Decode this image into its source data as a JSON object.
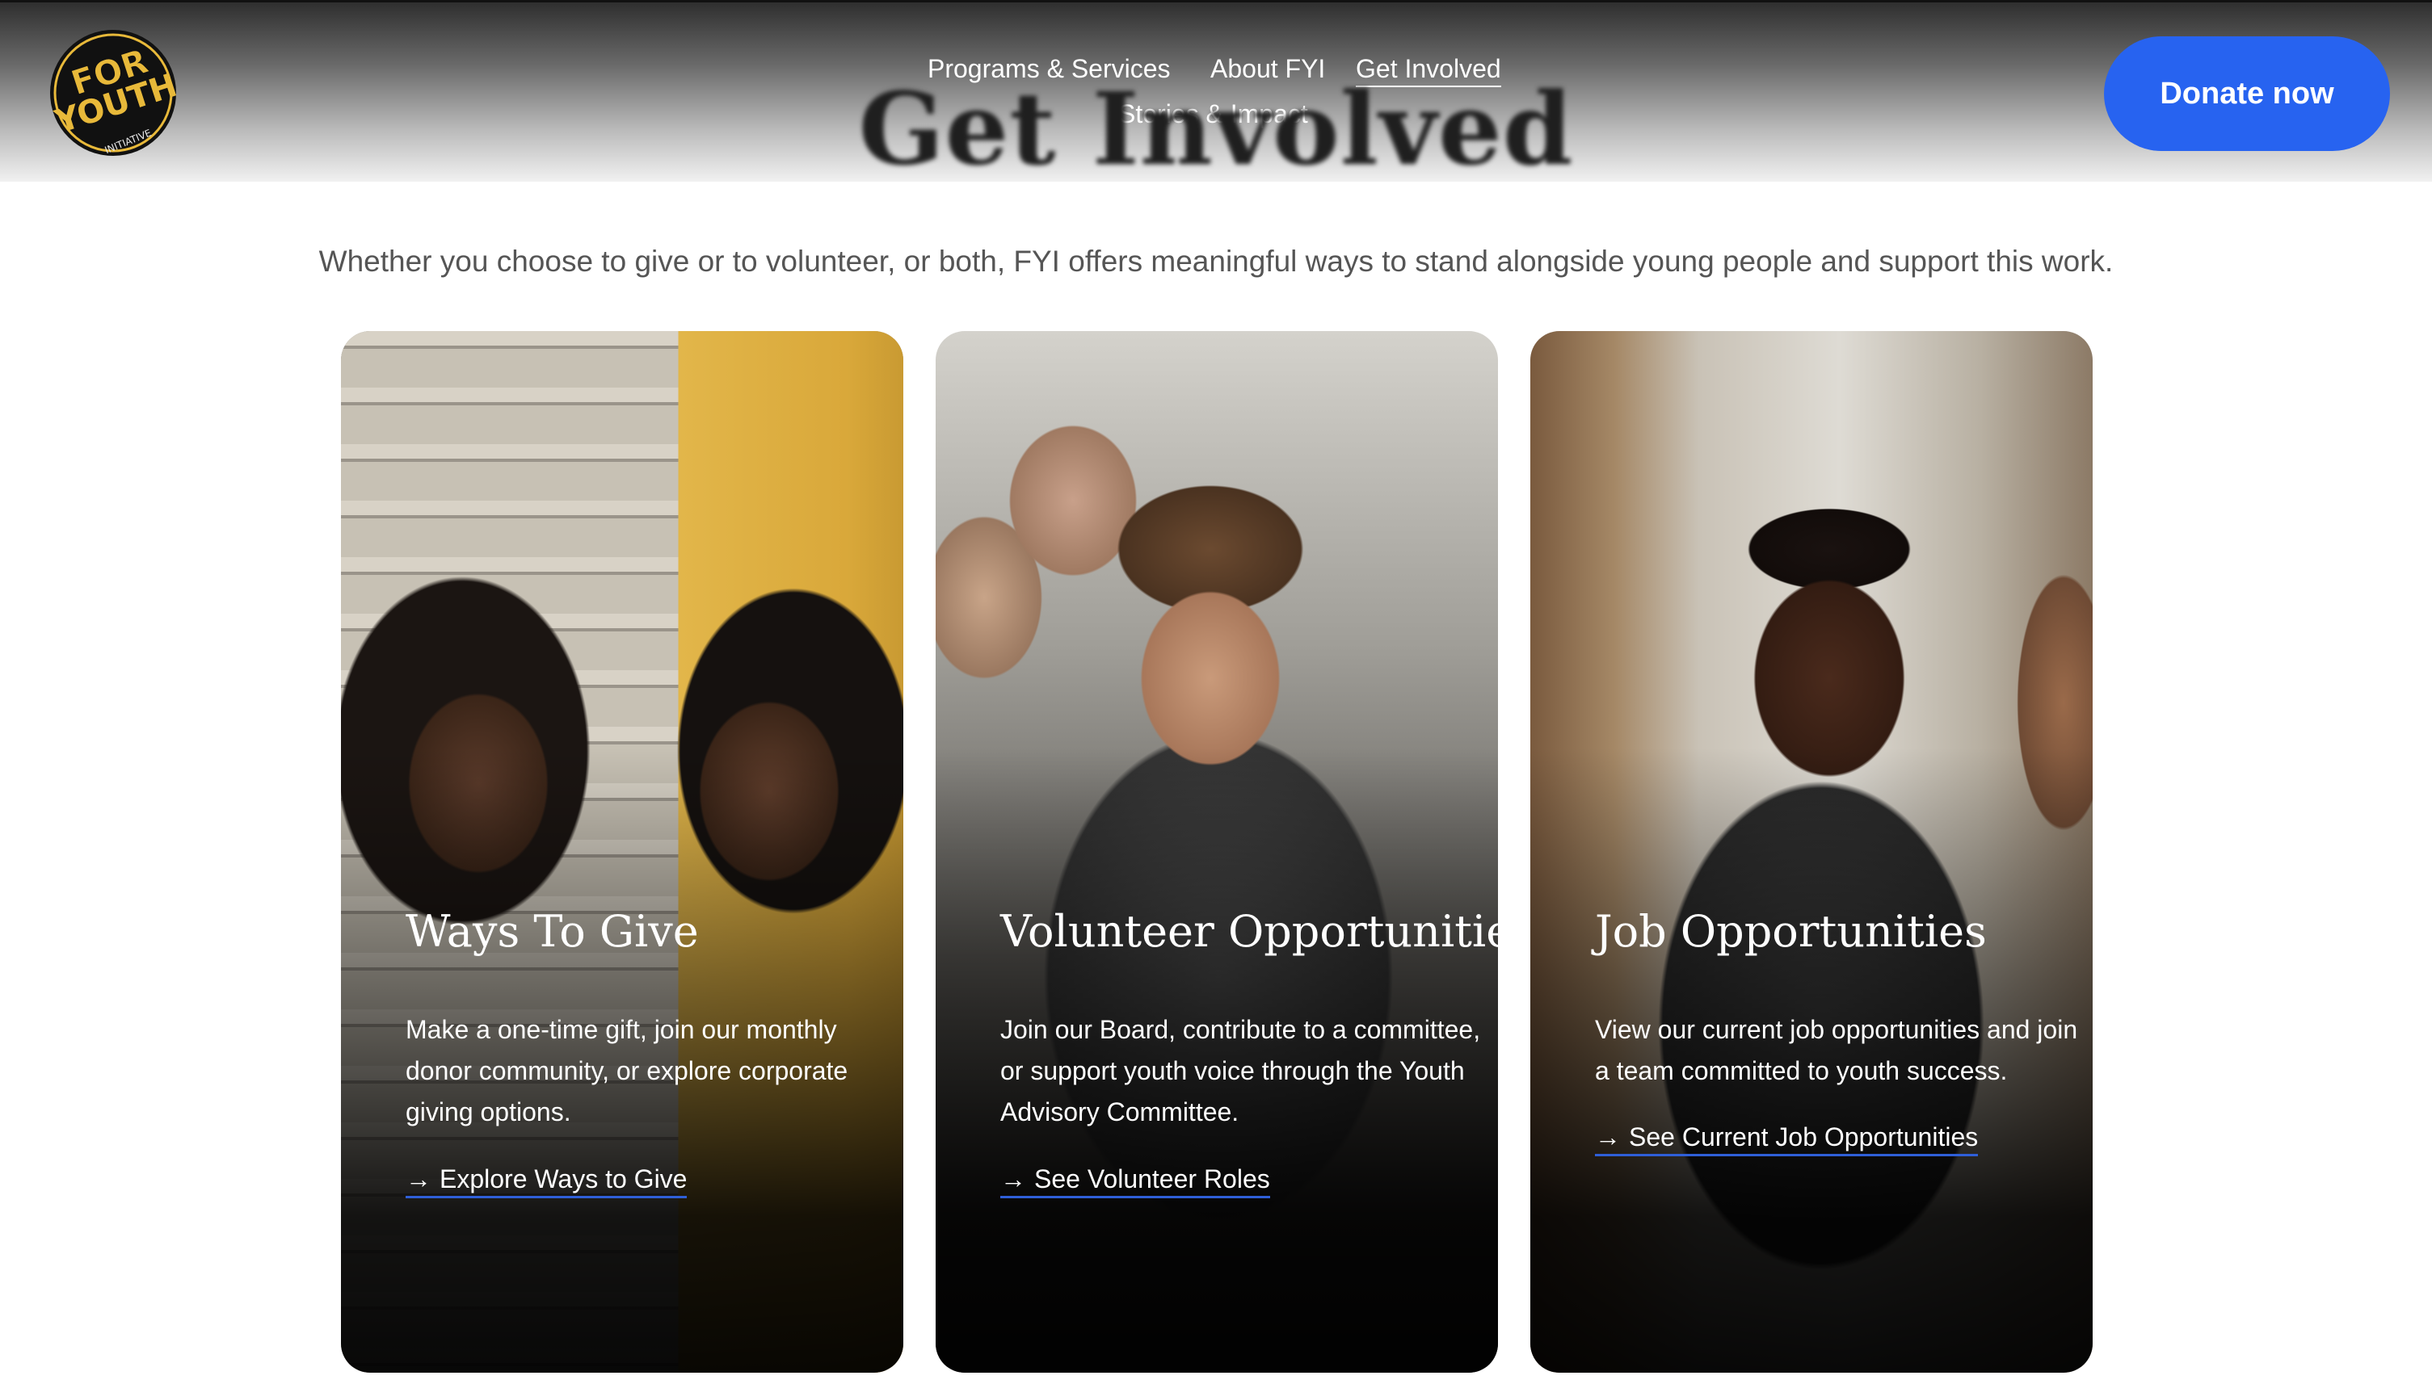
{
  "header": {
    "logo_alt": "FOR YOUTH INITIATIVE",
    "logo_text_top": "FOR",
    "logo_text_mid": "YOUTH",
    "logo_text_bottom": "INITIATIVE",
    "nav": [
      {
        "label": "Programs & Services"
      },
      {
        "label": "About FYI"
      },
      {
        "label": "Get Involved"
      },
      {
        "label": "Stories & Impact"
      }
    ],
    "donate_label": "Donate now",
    "colors": {
      "donate": "#2763f0",
      "logo_yellow": "#e8b93a"
    }
  },
  "hero": {
    "title": "Get Involved",
    "intro": "Whether you choose to give or to volunteer, or both, FYI offers meaningful ways to stand alongside young people and support this work."
  },
  "cards": [
    {
      "title": "Ways To Give",
      "description": "Make a one-time gift, join our monthly donor community, or explore corporate giving options.",
      "link_arrow": "→",
      "link_label": "Explore Ways to Give"
    },
    {
      "title": "Volunteer Opportunities",
      "description": "Join our Board, contribute to a committee, or support youth voice through the Youth Advisory Committee.",
      "link_arrow": "→",
      "link_label": "See Volunteer Roles"
    },
    {
      "title": "Job Opportunities",
      "description": "View our current job opportunities and join a team committed to youth success.",
      "link_arrow": "→",
      "link_label": "See Current Job Opportunities"
    }
  ]
}
